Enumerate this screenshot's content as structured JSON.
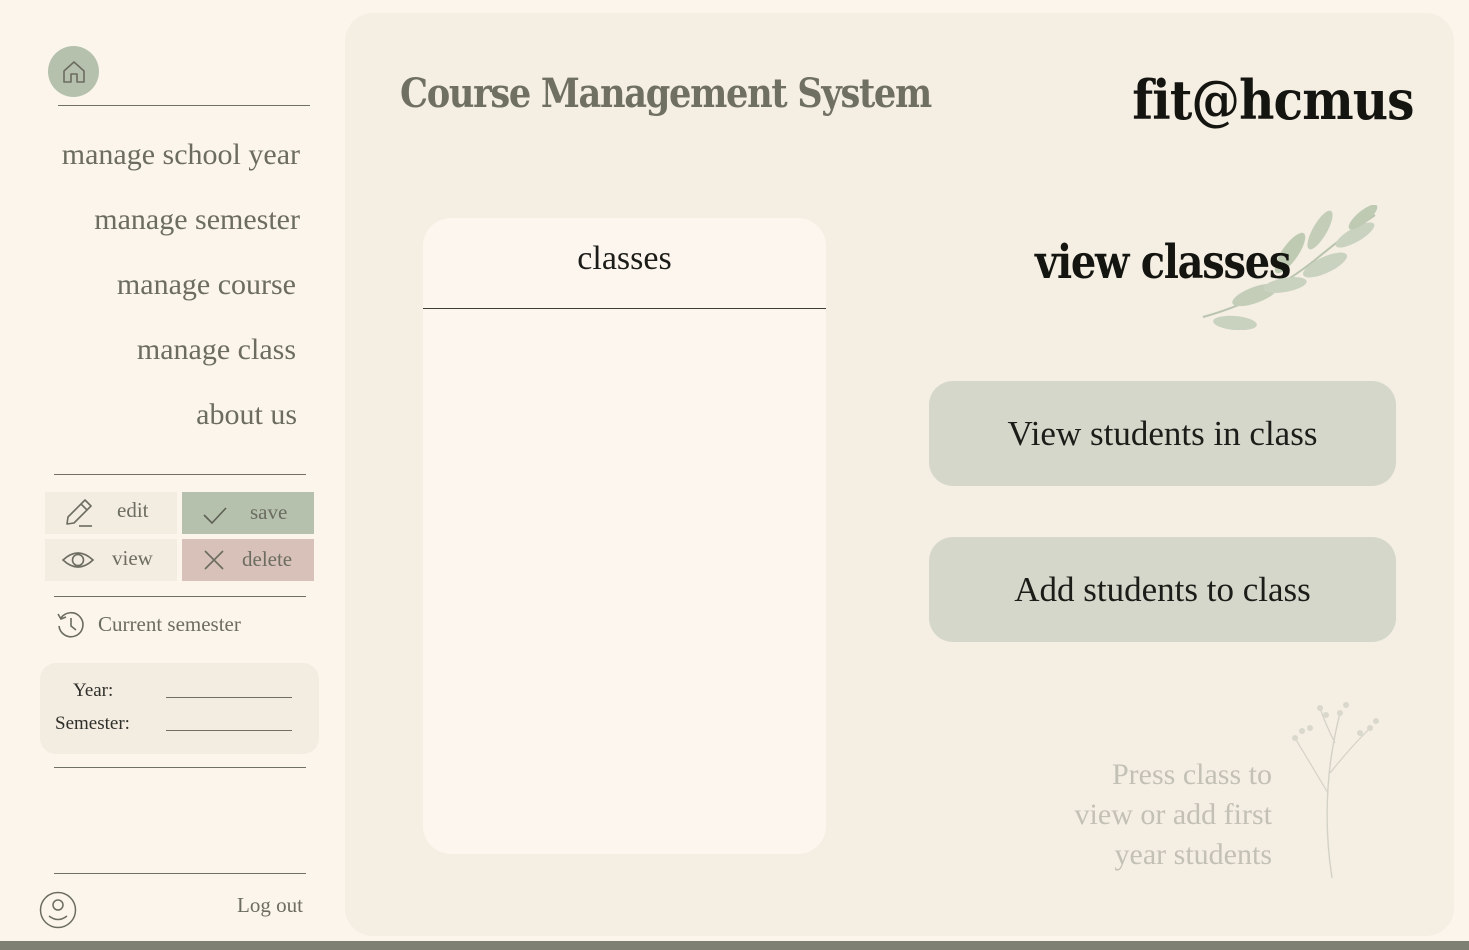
{
  "app": {
    "title": "Course Management System",
    "brand": "fit@hcmus"
  },
  "sidebar": {
    "home_icon": "home-icon",
    "nav": [
      {
        "label": "manage school year"
      },
      {
        "label": "manage semester"
      },
      {
        "label": "manage course"
      },
      {
        "label": "manage class"
      },
      {
        "label": "about us"
      }
    ],
    "tools": {
      "edit": {
        "label": "edit",
        "icon": "pencil-icon",
        "bg": "#f3ece1"
      },
      "save": {
        "label": "save",
        "icon": "check-icon",
        "bg": "#b5c1ad"
      },
      "view": {
        "label": "view",
        "icon": "eye-icon",
        "bg": "#f3ece1"
      },
      "delete": {
        "label": "delete",
        "icon": "x-icon",
        "bg": "#d8c1b8"
      }
    },
    "current_semester": {
      "label": "Current semester",
      "icon": "history-icon"
    },
    "semester_info": {
      "year_label": "Year:",
      "year_value": "",
      "semester_label": "Semester:",
      "semester_value": ""
    },
    "logout": {
      "label": "Log out",
      "icon": "user-icon"
    }
  },
  "main": {
    "classes_panel": {
      "title": "classes",
      "items": []
    },
    "heading": "view classes",
    "actions": [
      {
        "label": "View students in class"
      },
      {
        "label": "Add students to class"
      }
    ],
    "hint_lines": [
      "Press class to",
      "view or add first",
      "year students"
    ]
  },
  "colors": {
    "background": "#fbf5ec",
    "panel": "#f4eee3",
    "accent_green": "#b5c1ad",
    "accent_rose": "#d8c1b8",
    "button": "#d5d7cb"
  }
}
